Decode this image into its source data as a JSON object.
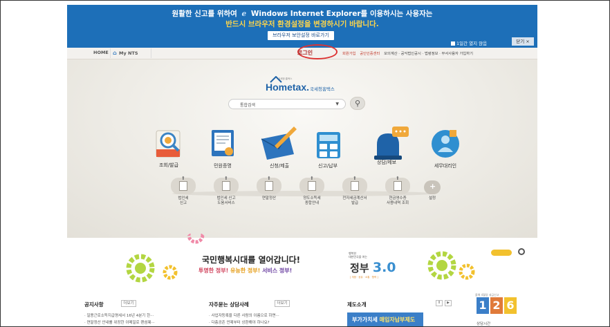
{
  "notice": {
    "line1_before": "원활한 신고를 위하여",
    "ie_icon": "ie-logo-icon",
    "line1_after": "Windows Internet Explorer를 이용하시는 사용자는",
    "line2": "반드시 브라우저 환경설정을 변경하시기 바랍니다.",
    "button": "브라우저 보안설정 바로가기",
    "checkbox_label": "1일간 열지 않음",
    "close": "닫기 ×"
  },
  "nav": {
    "home": "HOME",
    "my_nts": "My NTS",
    "login": "로그인",
    "links": [
      "회원가입",
      "공인인증센터",
      "모의계산 · 공익법인공시 · 법령정보 · 부서사용자 가입하기"
    ]
  },
  "logo": {
    "brand": "Hometax.",
    "sub": "국세청홈택스",
    "tagline": "국세청 홈택스"
  },
  "search": {
    "placeholder": "통합검색",
    "caret": "▼",
    "button_icon": "search-icon"
  },
  "main_menu": [
    {
      "label": "조회/발급",
      "icon": "inquiry-magnifier-icon"
    },
    {
      "label": "민원증명",
      "icon": "certificate-document-icon"
    },
    {
      "label": "신청/제출",
      "icon": "envelope-pen-icon"
    },
    {
      "label": "신고/납부",
      "icon": "calculator-icon"
    },
    {
      "label": "상담/제보",
      "icon": "siren-chat-icon"
    },
    {
      "label": "세무대리인",
      "icon": "tax-agent-person-icon"
    }
  ],
  "sub_menu": [
    {
      "label": "법인세\n신고"
    },
    {
      "label": "법인세 신고\n도움서비스"
    },
    {
      "label": "연말정산"
    },
    {
      "label": "양도소득세\n종합안내"
    },
    {
      "label": "전자세금계산서\n발급"
    },
    {
      "label": "현금영수증\n사용내역 조회"
    },
    {
      "label": "설정"
    }
  ],
  "banner": {
    "title": "국민행복시대를 열어갑니다!",
    "sub1": "투명한 정부!",
    "sub2": "유능한 정부!",
    "sub3": "서비스 정부!",
    "gov_top": "행복한\n대한민국을 여는",
    "gov_word": "정부",
    "gov_num": "3.0",
    "gov_foot": "[ 개방 · 공유 · 소통 · 협력 ]"
  },
  "sections": {
    "notices": {
      "title": "공지사항",
      "more": "더보기",
      "items": [
        "· 일용근로소득지급명세서 16년 4분기 한···",
        "· 연말정산 안내를 위장한 이메일로 랜섬웨···"
      ]
    },
    "faq": {
      "title": "자주묻는 상담사례",
      "more": "더보기",
      "items": [
        "· 사업자등록을 다른 사람의 이름으로 하면···",
        "· 다층공존 언제부터 상환해야 하나요?"
      ]
    },
    "system": {
      "title": "제도소개",
      "prev": "II",
      "next": "▶",
      "vat_a": "부가가치세",
      "vat_b": "매입자납부제도"
    },
    "schedule": {
      "top": "올해 4월달 세금신고",
      "digits": [
        "1",
        "2",
        "6"
      ],
      "label": "상담시간"
    }
  },
  "colors": {
    "notice_bg": "#1d6fb8",
    "notice_highlight": "#ffd54a",
    "login_ring": "#d33333",
    "brand_blue": "#1f63a8"
  }
}
